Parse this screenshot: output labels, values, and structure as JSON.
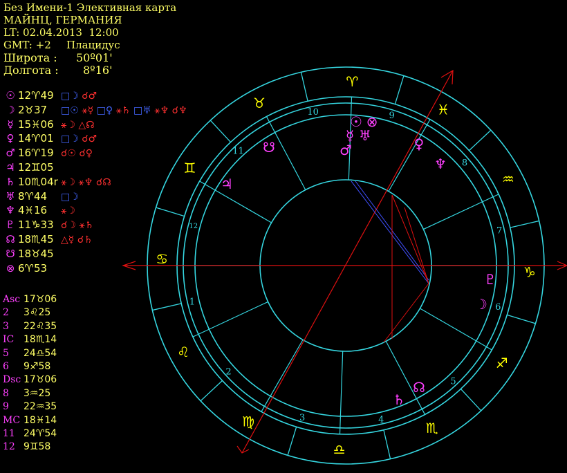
{
  "header": {
    "title": "Без Имени-1 Элективная карта",
    "place": "МАЙНЦ, ГЕРМАНИЯ",
    "local_time": "LT: 02.04.2013  12:00",
    "gmt": "GMT: +2",
    "house_system": "Плацидус",
    "latitude_label": "Широта :",
    "latitude_value": "50º01'",
    "longitude_label": "Долгота :",
    "longitude_value": "8º16'"
  },
  "colors": {
    "ring": "#35d6e0",
    "planet": "#ff40ff",
    "sign": "#ffff00",
    "red": "#e01010",
    "blue": "#4050ff",
    "house_num": "#35d6e0"
  },
  "planets": [
    {
      "glyph": "☉",
      "name": "sun-icon",
      "pos": "12♈49",
      "aspects": [
        {
          "t": "□☽",
          "c": "#4466ff"
        },
        {
          "t": "☌♂",
          "c": "#ff3030"
        }
      ]
    },
    {
      "glyph": "☽",
      "name": "moon-icon",
      "pos": "2♉37",
      "aspects": [
        {
          "t": "□☉",
          "c": "#4466ff"
        },
        {
          "t": "⚹☿",
          "c": "#ff3030"
        },
        {
          "t": "□♀",
          "c": "#4466ff"
        },
        {
          "t": "⚹♄",
          "c": "#ff3030"
        },
        {
          "t": "□♅",
          "c": "#4466ff"
        },
        {
          "t": "⚹♆",
          "c": "#ff3030"
        },
        {
          "t": "☌♆",
          "c": "#ff3030"
        }
      ]
    },
    {
      "glyph": "☿",
      "name": "mercury-icon",
      "pos": "15♓06",
      "aspects": [
        {
          "t": "⚹☽",
          "c": "#ff3030"
        },
        {
          "t": "△☊",
          "c": "#ff3030"
        }
      ]
    },
    {
      "glyph": "♀",
      "name": "venus-icon",
      "pos": "14♈01",
      "aspects": [
        {
          "t": "□☽",
          "c": "#4466ff"
        },
        {
          "t": "☌♂",
          "c": "#ff3030"
        }
      ]
    },
    {
      "glyph": "♂",
      "name": "mars-icon",
      "pos": "16♈19",
      "aspects": [
        {
          "t": "☌☉",
          "c": "#ff3030"
        },
        {
          "t": "☌♀",
          "c": "#ff3030"
        }
      ]
    },
    {
      "glyph": "♃",
      "name": "jupiter-icon",
      "pos": "12♊05",
      "aspects": []
    },
    {
      "glyph": "♄",
      "name": "saturn-icon",
      "pos": "10♏04r",
      "aspects": [
        {
          "t": "⚹☽",
          "c": "#ff3030"
        },
        {
          "t": "⚹♆",
          "c": "#ff3030"
        },
        {
          "t": "☌☊",
          "c": "#ff3030"
        }
      ]
    },
    {
      "glyph": "♅",
      "name": "uranus-icon",
      "pos": "8♈44",
      "aspects": [
        {
          "t": "□☽",
          "c": "#4466ff"
        }
      ]
    },
    {
      "glyph": "♆",
      "name": "neptune-icon",
      "pos": "4♓16",
      "aspects": [
        {
          "t": "⚹☽",
          "c": "#ff3030"
        }
      ]
    },
    {
      "glyph": "♇",
      "name": "pluto-icon",
      "pos": "11♑33",
      "aspects": [
        {
          "t": "☌☽",
          "c": "#ff3030"
        },
        {
          "t": "⚹♄",
          "c": "#ff3030"
        }
      ]
    },
    {
      "glyph": "☊",
      "name": "north-node-icon",
      "pos": "18♏45",
      "aspects": [
        {
          "t": "△☿",
          "c": "#ff3030"
        },
        {
          "t": "☌♄",
          "c": "#ff3030"
        }
      ]
    },
    {
      "glyph": "☋",
      "name": "south-node-icon",
      "pos": "18♉45",
      "aspects": []
    },
    {
      "glyph": "⊗",
      "name": "part-of-fortune-icon",
      "pos": "6♈53",
      "aspects": []
    }
  ],
  "houses": [
    {
      "label": "Asc",
      "value": "17♉06"
    },
    {
      "label": "2",
      "value": "3♌25"
    },
    {
      "label": "3",
      "value": "22♌35"
    },
    {
      "label": "IC",
      "value": "18♏14"
    },
    {
      "label": "5",
      "value": "24♎54"
    },
    {
      "label": "6",
      "value": "9♐58"
    },
    {
      "label": "Dsc",
      "value": "17♉06"
    },
    {
      "label": "8",
      "value": "3♒25"
    },
    {
      "label": "9",
      "value": "22♒35"
    },
    {
      "label": "MC",
      "value": "18♓14"
    },
    {
      "label": "11",
      "value": "24♈54"
    },
    {
      "label": "12",
      "value": "9♊58"
    }
  ],
  "wheel": {
    "sign_glyphs": [
      "♈",
      "♉",
      "♓",
      "♒",
      "♑",
      "♐",
      "♏",
      "♎",
      "♍",
      "♌",
      "♋",
      "♊"
    ],
    "house_numbers": [
      "1",
      "2",
      "3",
      "4",
      "5",
      "6",
      "7",
      "8",
      "9",
      "10",
      "11",
      "12"
    ],
    "chart_planets": [
      "☉",
      "⊗",
      "☿",
      "♅",
      "♂",
      "♀",
      "♆",
      "♃",
      "☋",
      "♇",
      "☽",
      "☊",
      "♄"
    ]
  }
}
